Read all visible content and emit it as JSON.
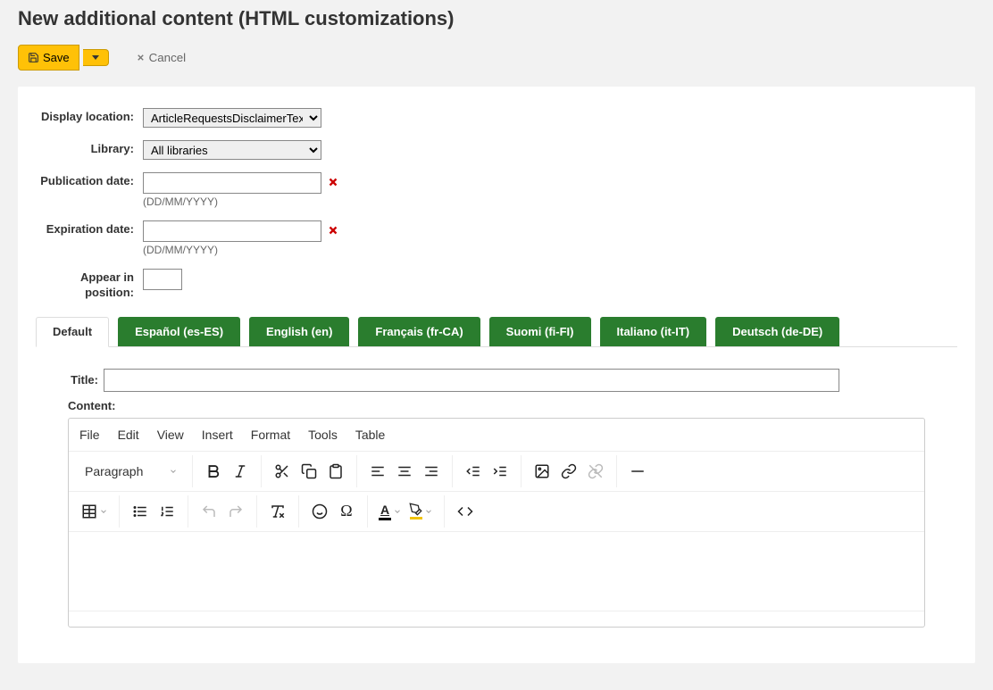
{
  "page": {
    "title": "New additional content (HTML customizations)"
  },
  "toolbar": {
    "save_label": "Save",
    "cancel_label": "Cancel"
  },
  "form": {
    "display_location": {
      "label": "Display location:",
      "value": "ArticleRequestsDisclaimerText"
    },
    "library": {
      "label": "Library:",
      "value": "All libraries"
    },
    "publication_date": {
      "label": "Publication date:",
      "value": "",
      "hint": "(DD/MM/YYYY)"
    },
    "expiration_date": {
      "label": "Expiration date:",
      "value": "",
      "hint": "(DD/MM/YYYY)"
    },
    "appear_position": {
      "label": "Appear in position:",
      "value": ""
    }
  },
  "tabs": [
    {
      "label": "Default"
    },
    {
      "label": "Español (es-ES)"
    },
    {
      "label": "English (en)"
    },
    {
      "label": "Français (fr-CA)"
    },
    {
      "label": "Suomi (fi-FI)"
    },
    {
      "label": "Italiano (it-IT)"
    },
    {
      "label": "Deutsch (de-DE)"
    }
  ],
  "tab_body": {
    "title_label": "Title:",
    "title_value": "",
    "content_label": "Content:"
  },
  "editor": {
    "menu": [
      "File",
      "Edit",
      "View",
      "Insert",
      "Format",
      "Tools",
      "Table"
    ],
    "paragraph_label": "Paragraph"
  }
}
